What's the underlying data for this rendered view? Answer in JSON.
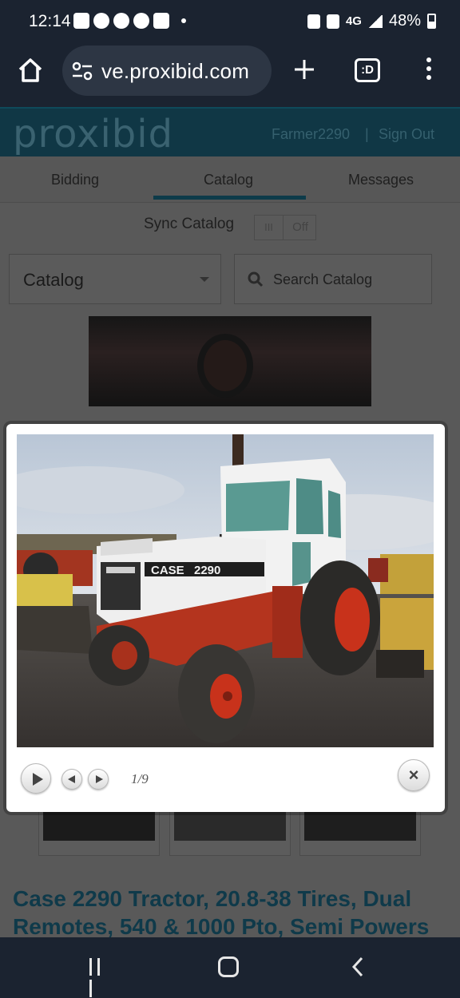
{
  "status_bar": {
    "time": "12:14",
    "network": "4G",
    "battery": "48%"
  },
  "browser": {
    "url": "ve.proxibid.com",
    "tabs_label": ":D"
  },
  "site": {
    "logo": "proxibid",
    "username": "Farmer2290",
    "separator": "|",
    "sign_out": "Sign Out",
    "tabs": [
      "Bidding",
      "Catalog",
      "Messages"
    ],
    "active_tab": "Catalog",
    "sync_label": "Sync Catalog",
    "sync_on_label": "III",
    "sync_off_label": "Off",
    "catalog_select": "Catalog",
    "search_placeholder": "Search Catalog",
    "lot_title": "Case 2290 Tractor, 20.8-38 Tires, Dual Remotes, 540 & 1000 Pto, Semi Powers"
  },
  "lightbox": {
    "counter": "1/9",
    "close": "×",
    "photo_alt": "Case 2290 tractor",
    "brand_decal": "CASE",
    "model_decal": "2290"
  },
  "colors": {
    "accent": "#0d3b4a",
    "tractor_red": "#c8321b",
    "tractor_white": "#efefef"
  },
  "icons": [
    "home-icon",
    "tune-icon",
    "plus-icon",
    "tabs-icon",
    "more-icon",
    "search-icon",
    "play-icon",
    "prev-icon",
    "next-icon",
    "close-icon",
    "recents-icon",
    "back-icon"
  ]
}
